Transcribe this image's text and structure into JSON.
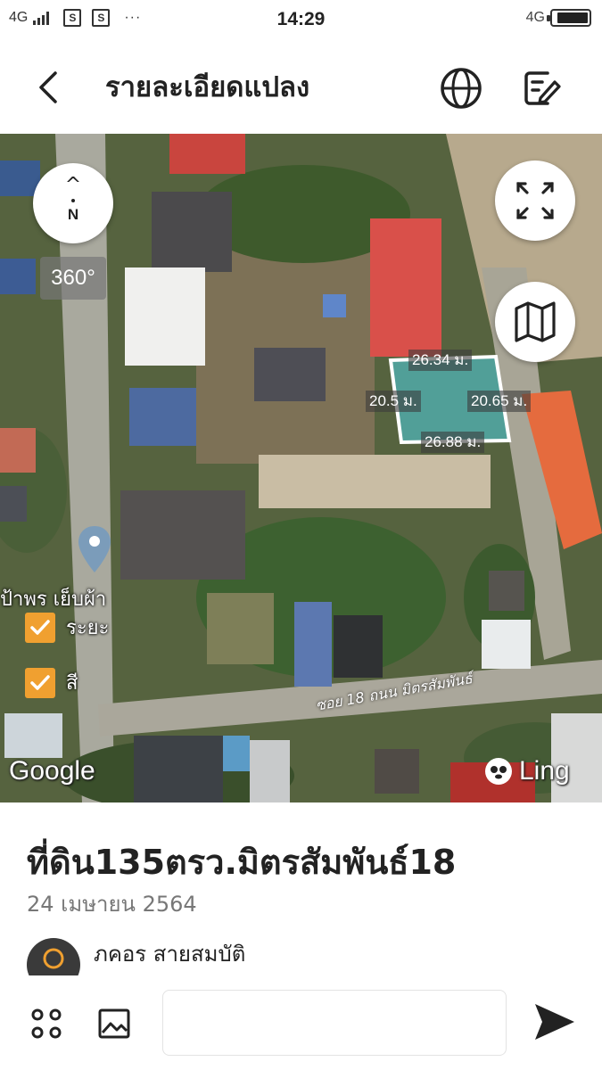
{
  "status_bar": {
    "network_left": "4G",
    "more": "···",
    "sim_icon": "S",
    "time": "14:29",
    "network_right": "4G",
    "battery_level": 0.9
  },
  "header": {
    "title": "รายละเอียดแปลง",
    "icons": [
      "back-icon",
      "globe-icon",
      "edit-icon"
    ]
  },
  "map": {
    "compass_arrow": "^",
    "compass_letter": "N",
    "view360": "360°",
    "dimensions": {
      "top": "26.34 ม.",
      "left": "20.5 ม.",
      "right": "20.65 ม.",
      "bottom": "26.88 ม."
    },
    "place_label": "ป้าพร เย็บผ้า",
    "checkbox_distance": "ระยะ",
    "checkbox_color": "สี",
    "road_label": "ซอย 18 ถนน มิตรสัมพันธ์",
    "google": "Google",
    "ling": "Ling",
    "plot_color": "#4fc0c8",
    "checkbox_accent": "#f0a030"
  },
  "post": {
    "title": "ที่ดิน135ตรว.มิตรสัมพันธ์18",
    "date": "24 เมษายน 2564",
    "author": "ภคอร สายสมบัติ"
  },
  "composer": {
    "placeholder": ""
  }
}
